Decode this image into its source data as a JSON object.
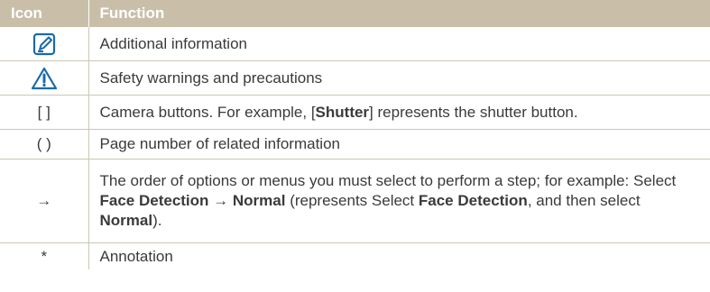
{
  "header": {
    "icon": "Icon",
    "function": "Function"
  },
  "rows": [
    {
      "icon": "note-icon",
      "text": "Additional information"
    },
    {
      "icon": "warning-triangle-icon",
      "text": "Safety warnings and precautions"
    },
    {
      "symbol": "[ ]",
      "text_pre": "Camera buttons. For example, [",
      "text_bold": "Shutter",
      "text_post": "] represents the shutter button."
    },
    {
      "symbol": "( )",
      "text": "Page number of related information"
    },
    {
      "symbol": "→",
      "p1": "The order of options or menus you must select to perform a step; for example: Select ",
      "b1": "Face Detection",
      "p2": " → ",
      "b2": "Normal",
      "p3": " (represents Select ",
      "b3": "Face Detection",
      "p4": ", and then select ",
      "b4": "Normal",
      "p5": ")."
    },
    {
      "symbol": "*",
      "text": "Annotation"
    }
  ],
  "colors": {
    "header_bg": "#c9bfa9",
    "accent": "#1a6aa8",
    "rule": "#cdc6b4"
  }
}
